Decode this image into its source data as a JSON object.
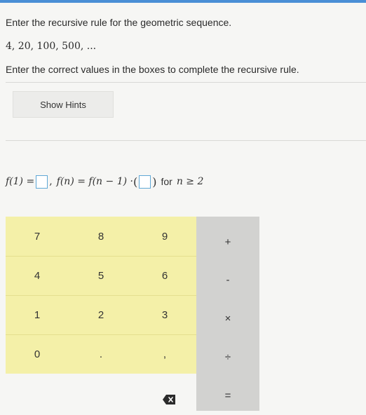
{
  "question": {
    "title": "Enter the recursive rule for the geometric sequence.",
    "sequence": "4, 20, 100, 500, ...",
    "instructions": "Enter the correct values in the boxes to complete the recursive rule."
  },
  "hints": {
    "label": "Show Hints"
  },
  "formula": {
    "part1": "f(1) = ",
    "sep": ",",
    "part2": "f(n) = f(n − 1) · ",
    "open_paren": "(",
    "close_paren": ")",
    "condition_word": "for",
    "condition": "n ≥ 2"
  },
  "keypad": {
    "digits": [
      "7",
      "8",
      "9",
      "4",
      "5",
      "6",
      "1",
      "2",
      "3",
      "0",
      ".",
      ","
    ],
    "operators": [
      "+",
      "-",
      "×",
      "÷",
      "="
    ],
    "backspace_icon": "backspace-icon"
  },
  "colors": {
    "digit_pad_bg": "#f4f0a8",
    "operator_pad_bg": "#d2d2d0",
    "input_box_border": "#5fa8d6"
  }
}
